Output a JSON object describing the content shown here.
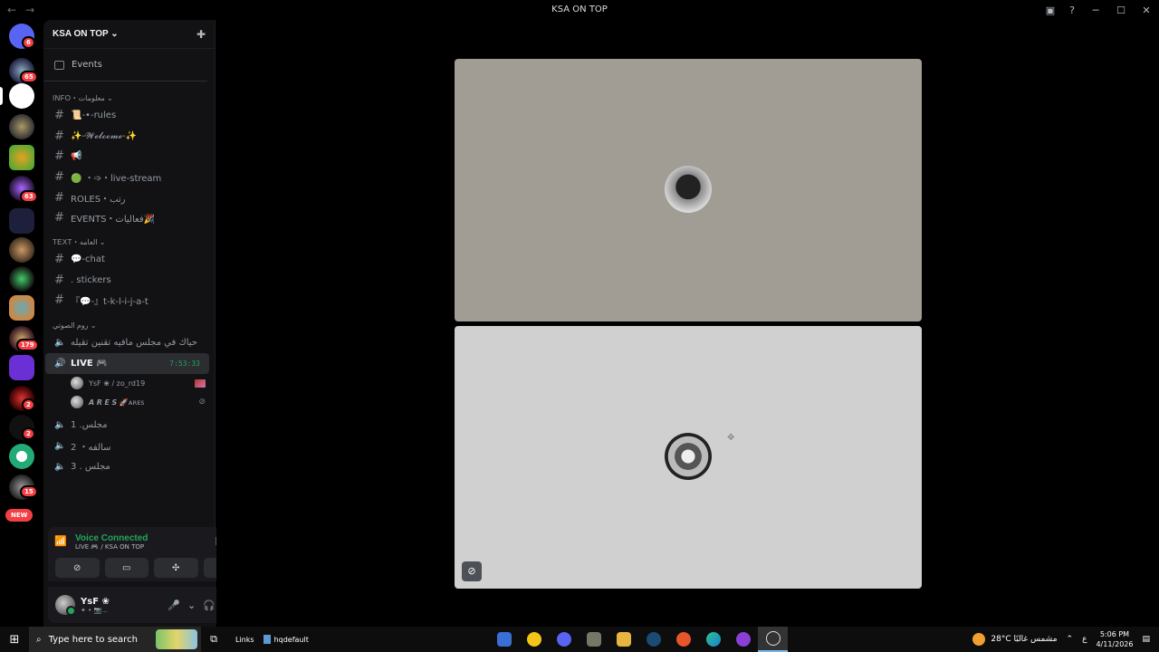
{
  "window": {
    "title": "KSA ON TOP",
    "back": "←",
    "forward": "→"
  },
  "rail": {
    "badges": [
      "6",
      "65",
      "63",
      "179",
      "2",
      "2",
      "15"
    ],
    "new_label": "NEW"
  },
  "server": {
    "name": "KSA ON TOP",
    "chevron": "⌄",
    "invite_icon": "✚"
  },
  "events_label": "Events",
  "categories": {
    "info": "INFO・معلومات ⌄",
    "text": "TEXT・العامه ⌄",
    "voice": "روم الصوتي ⌄"
  },
  "channels": {
    "rules": "📜-•-rules",
    "welcome": "✨-𝓦𝓮𝓵𝓬𝓸𝓶𝓮-✨",
    "announce": "📢",
    "live_stream": "🟢 ・➩・live-stream",
    "roles": "ROLES・رتب",
    "events": "EVENTS・فعاليات🎉",
    "chat": "💬-chat",
    "stickers": ". stickers",
    "tiktok": "『💬-』t-k-l-i-j-a-t",
    "voice_top": "حياك في مجلس مافيه تقنين تقيله",
    "live": "LIVE 🎮",
    "live_timer": "7:53:33",
    "v1": "مجلس. 1",
    "v2": "سالفه・ 2",
    "v3": "مجلس . 3"
  },
  "voice_users": [
    {
      "name": "YsF ❀ / zo_rd19"
    },
    {
      "name": "𝘼 𝙍 𝙀 𝙎 🚀ᴀʀᴇꜱ"
    }
  ],
  "voice_panel": {
    "status": "Voice Connected",
    "location": "LIVE 🎮 / KSA ON TOP"
  },
  "user_panel": {
    "name": "YsF ❀",
    "status": "✦ • 📷..."
  },
  "taskbar": {
    "search_placeholder": "Type here to search",
    "links": "Links",
    "folder": "hqdefault",
    "weather": "28°C  مشمس غالبًا",
    "lang": "ع",
    "time": "5:06 PM",
    "date": "4/11/2026"
  },
  "colors": {
    "green": "#23a55a",
    "tile1": "#a29d94",
    "tile2": "#d0d0d0",
    "badge": "#f23f43"
  }
}
